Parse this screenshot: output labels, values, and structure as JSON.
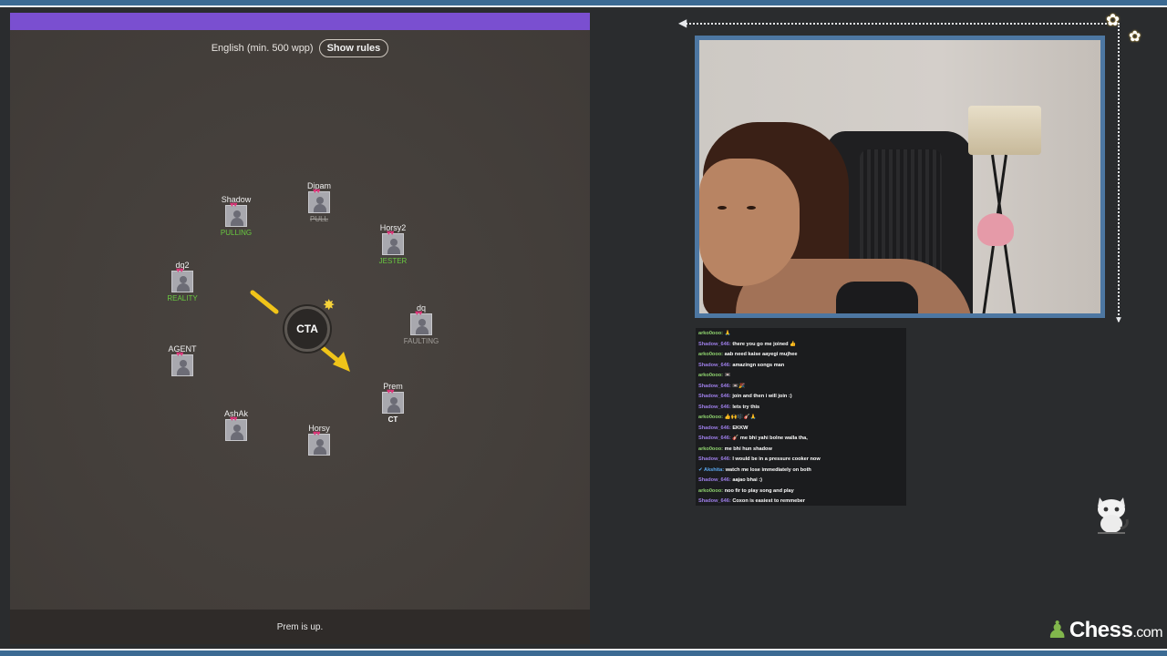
{
  "game": {
    "language_label": "English (min. 500 wpp)",
    "show_rules_label": "Show rules",
    "syllable": "CTA",
    "status_text": "Prem is up.",
    "players": [
      {
        "name": "Dipam",
        "word": "PULL",
        "word_style": "strike"
      },
      {
        "name": "Shadow",
        "word": "PULLING",
        "word_style": "green"
      },
      {
        "name": "Horsy2",
        "word": "JESTER",
        "word_style": "green"
      },
      {
        "name": "dq2",
        "word": "REALITY",
        "word_style": "green"
      },
      {
        "name": "dq",
        "word": "FAULTING",
        "word_style": "gray"
      },
      {
        "name": "AGENT",
        "word": "",
        "word_style": "gray"
      },
      {
        "name": "Prem",
        "word": "CT",
        "word_style": "white"
      },
      {
        "name": "AshAk",
        "word": "",
        "word_style": "gray"
      },
      {
        "name": "Horsy",
        "word": "",
        "word_style": "gray"
      }
    ]
  },
  "chat": {
    "messages": [
      {
        "user": "arko0ooo:",
        "type": "arko",
        "text": "🙏"
      },
      {
        "user": "Shadow_646:",
        "type": "shadow",
        "text": "there you go me joined 👍"
      },
      {
        "user": "arko0ooo:",
        "type": "arko",
        "text": "aab need kaise aayegi mujhee"
      },
      {
        "user": "Shadow_646:",
        "type": "shadow",
        "text": "amazingn songs man"
      },
      {
        "user": "arko0ooo:",
        "type": "arko",
        "text": "📼"
      },
      {
        "user": "Shadow_646:",
        "type": "shadow",
        "text": "📼🎉"
      },
      {
        "user": "Shadow_646:",
        "type": "shadow",
        "text": "join and then i will join :)"
      },
      {
        "user": "Shadow_646:",
        "type": "shadow",
        "text": "lets try this"
      },
      {
        "user": "arko0ooo:",
        "type": "arko",
        "text": "👍🙌🎼🎸🙏"
      },
      {
        "user": "Shadow_646:",
        "type": "shadow",
        "text": "EKKW"
      },
      {
        "user": "Shadow_646:",
        "type": "shadow",
        "text": "🎸 me bhi yahi bolne walla tha,"
      },
      {
        "user": "arko0ooo:",
        "type": "arko",
        "text": "me bhi hun shadow"
      },
      {
        "user": "Shadow_646:",
        "type": "shadow",
        "text": "I would be in a pressure cooker now"
      },
      {
        "user": "✔ Akshita:",
        "type": "akshita",
        "text": "watch me lose immediately on both"
      },
      {
        "user": "Shadow_646:",
        "type": "shadow",
        "text": "aajao bhai :)"
      },
      {
        "user": "arko0ooo:",
        "type": "arko",
        "text": "noo fir to play song and play"
      },
      {
        "user": "Shadow_646:",
        "type": "shadow",
        "text": "Coxon is easiest to remmeber"
      }
    ]
  },
  "branding": {
    "logo_text": "Chess",
    "logo_suffix": ".com"
  },
  "colors": {
    "game_top_bar": "#7a4fd0",
    "webcam_border": "#4d77a2",
    "frame_blue": "#3b6a93",
    "chess_green": "#81b64c",
    "word_green": "#69c940",
    "arrow_yellow": "#f0c419"
  }
}
